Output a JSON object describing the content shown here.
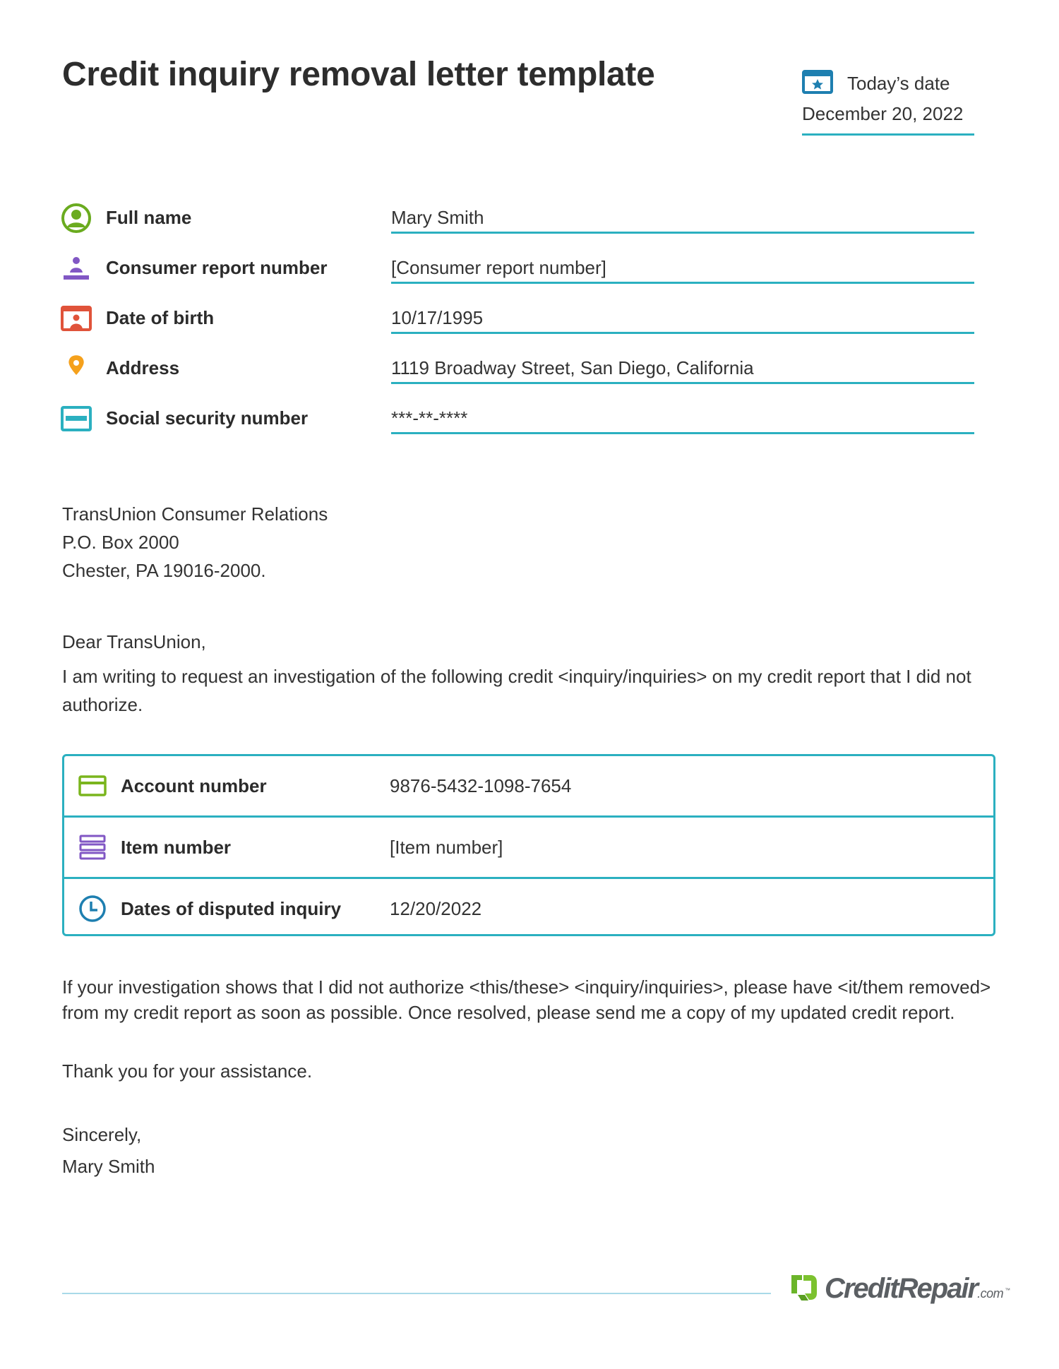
{
  "header": {
    "title": "Credit inquiry removal letter template",
    "date_label": "Today’s date",
    "date_value": "December 20, 2022"
  },
  "fields": [
    {
      "label": "Full name",
      "value": "Mary Smith",
      "icon": "user-circle-icon",
      "color": "#6aab1f"
    },
    {
      "label": "Consumer report number",
      "value": "[Consumer report number]",
      "icon": "person-podium-icon",
      "color": "#8157c4"
    },
    {
      "label": "Date of birth",
      "value": "10/17/1995",
      "icon": "id-card-icon",
      "color": "#e0533a"
    },
    {
      "label": "Address",
      "value": "1119 Broadway Street, San Diego, California",
      "icon": "map-pin-icon",
      "color": "#f5a11c"
    },
    {
      "label": "Social security number",
      "value": "***-**-****",
      "icon": "card-stripe-icon",
      "color": "#2bb0c0"
    }
  ],
  "recipient": {
    "line1": "TransUnion Consumer Relations",
    "line2": "P.O. Box 2000",
    "line3": "Chester, PA 19016-2000."
  },
  "letter": {
    "greeting": "Dear TransUnion,",
    "intro": "I am writing to request an investigation of the following credit <inquiry/inquiries> on my credit report that I did not authorize.",
    "request": "If your investigation shows that I did not authorize <this/these> <inquiry/inquiries>, please have <it/them removed> from my credit report as soon as possible. Once resolved, please send me a copy of my updated credit report.",
    "thanks": "Thank you for your assistance.",
    "closing": "Sincerely,",
    "signature": "Mary Smith"
  },
  "details": [
    {
      "label": "Account number",
      "value": "9876-5432-1098-7654",
      "icon": "credit-card-icon",
      "color": "#7ab51d"
    },
    {
      "label": "Item number",
      "value": "[Item number]",
      "icon": "stacked-list-icon",
      "color": "#8157c4"
    },
    {
      "label": "Dates of disputed inquiry",
      "value": "12/20/2022",
      "icon": "clock-icon",
      "color": "#1e7fb0"
    }
  ],
  "footer": {
    "brand": "CreditRepair",
    "brand_suffix": ".com",
    "trademark": "™",
    "brand_color": "#6bb52a"
  },
  "colors": {
    "accent": "#2bb0c0",
    "calendar": "#1e7fb0",
    "text": "#333333"
  }
}
